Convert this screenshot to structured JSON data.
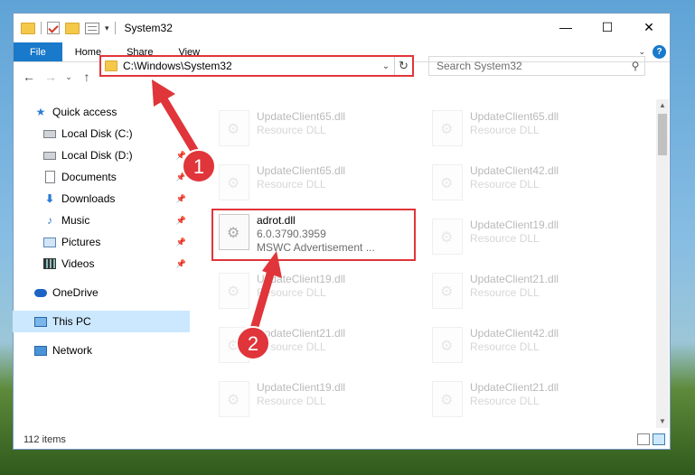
{
  "window": {
    "title": "System32"
  },
  "title_controls": {
    "minimize": "—",
    "maximize": "☐",
    "close": "✕"
  },
  "ribbon": {
    "tabs": [
      "File",
      "Home",
      "Share",
      "View"
    ],
    "help": "?"
  },
  "address": {
    "path": "C:\\Windows\\System32"
  },
  "search": {
    "placeholder": "Search System32"
  },
  "sidebar": {
    "items": [
      {
        "label": "Quick access",
        "icon": "star-icon"
      },
      {
        "label": "Local Disk (C:)",
        "icon": "disk-icon"
      },
      {
        "label": "Local Disk (D:)",
        "icon": "disk-icon",
        "pinned": true
      },
      {
        "label": "Documents",
        "icon": "documents-icon",
        "pinned": true
      },
      {
        "label": "Downloads",
        "icon": "downloads-icon",
        "pinned": true
      },
      {
        "label": "Music",
        "icon": "music-icon",
        "pinned": true
      },
      {
        "label": "Pictures",
        "icon": "pictures-icon",
        "pinned": true
      },
      {
        "label": "Videos",
        "icon": "videos-icon",
        "pinned": true
      },
      {
        "label": "OneDrive",
        "icon": "onedrive-icon"
      },
      {
        "label": "This PC",
        "icon": "this-pc-icon",
        "selected": true
      },
      {
        "label": "Network",
        "icon": "network-icon"
      }
    ]
  },
  "files": [
    {
      "name": "UpdateClient65.dll",
      "desc": "Resource DLL"
    },
    {
      "name": "UpdateClient65.dll",
      "desc": "Resource DLL"
    },
    {
      "name": "UpdateClient65.dll",
      "desc": "Resource DLL"
    },
    {
      "name": "UpdateClient42.dll",
      "desc": "Resource DLL"
    },
    {
      "name": "adrot.dll",
      "version": "6.0.3790.3959",
      "desc": "MSWC Advertisement ..."
    },
    {
      "name": "UpdateClient19.dll",
      "desc": "Resource DLL"
    },
    {
      "name": "UpdateClient19.dll",
      "desc": "Resource DLL"
    },
    {
      "name": "UpdateClient21.dll",
      "desc": "Resource DLL"
    },
    {
      "name": "UpdateClient21.dll",
      "desc": "Resource DLL"
    },
    {
      "name": "UpdateClient42.dll",
      "desc": "Resource DLL"
    },
    {
      "name": "UpdateClient19.dll",
      "desc": "Resource DLL"
    },
    {
      "name": "UpdateClient21.dll",
      "desc": "Resource DLL"
    }
  ],
  "status": {
    "count": "112 items"
  },
  "annotations": {
    "step1": "1",
    "step2": "2",
    "color": "#e0353a"
  }
}
